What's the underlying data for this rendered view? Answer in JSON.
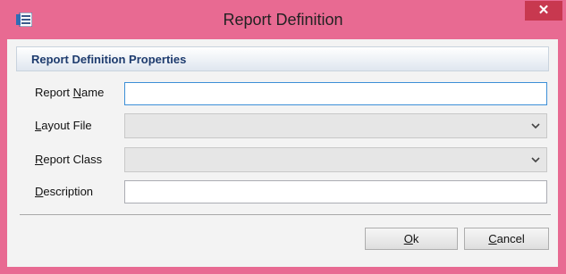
{
  "window": {
    "title": "Report Definition",
    "close_glyph": "✕",
    "app_icon": "report-icon"
  },
  "group": {
    "title": "Report Definition Properties"
  },
  "fields": {
    "report_name": {
      "label": "Report Name",
      "mnemonic": "N",
      "value": ""
    },
    "layout_file": {
      "label": "Layout File",
      "mnemonic": "L",
      "value": ""
    },
    "report_class": {
      "label": "Report Class",
      "mnemonic": "R",
      "value": ""
    },
    "description": {
      "label": "Description",
      "mnemonic": "D",
      "value": ""
    }
  },
  "buttons": {
    "ok": {
      "label": "Ok",
      "mnemonic": "O"
    },
    "cancel": {
      "label": "Cancel",
      "mnemonic": "C"
    }
  },
  "colors": {
    "window_accent": "#e86a92",
    "close_button": "#c8384f",
    "group_title": "#1d3b6e"
  }
}
